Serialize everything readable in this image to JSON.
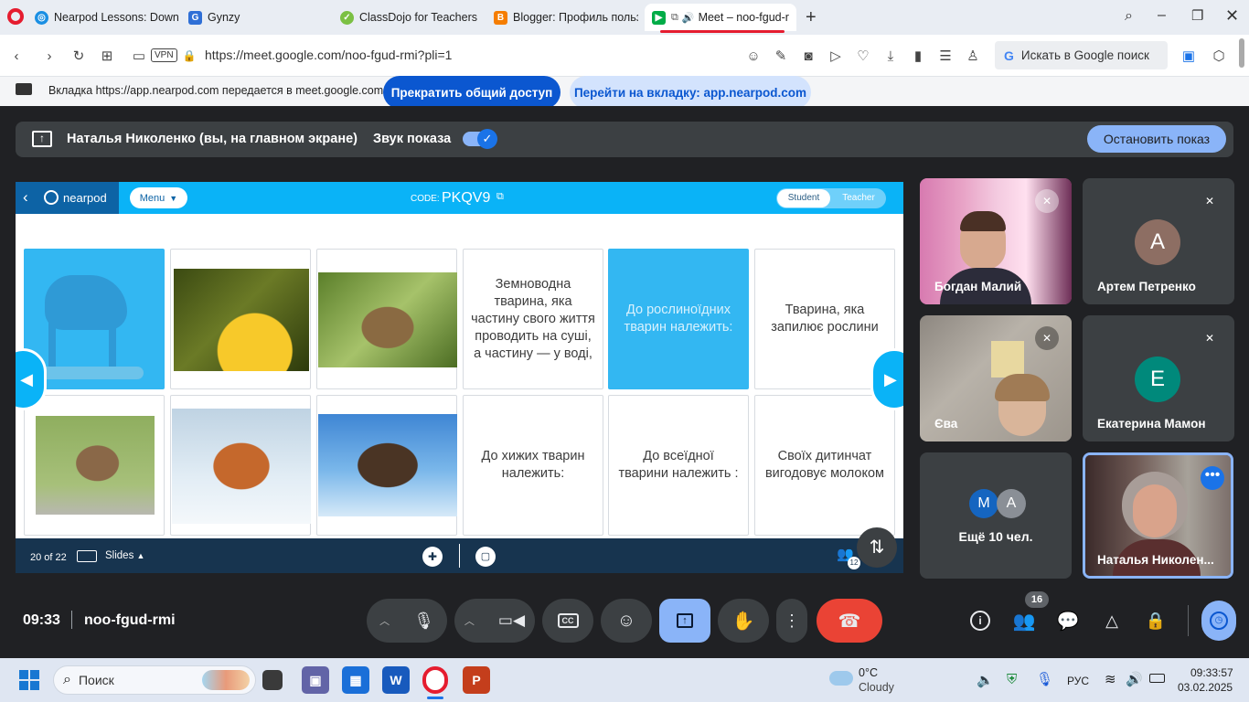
{
  "browser": {
    "tabs": [
      {
        "title": "Nearpod Lessons: Downlo",
        "active": false
      },
      {
        "title": "Gynzy",
        "active": false
      },
      {
        "title": "ClassDojo for Teachers",
        "active": false
      },
      {
        "title": "Blogger: Профиль пользо",
        "active": false
      },
      {
        "title": "Meet – noo-fgud-r",
        "active": true
      }
    ],
    "new_tab_icon": "plus-icon",
    "vpn_label": "VPN",
    "url": "https://meet.google.com/noo-fgud-rmi?pli=1",
    "search_placeholder": "Искать в Google поиск",
    "search_badge": "G"
  },
  "share_bar": {
    "text": "Вкладка https://app.nearpod.com передается в meet.google.com",
    "stop_label": "Прекратить общий доступ",
    "goto_label": "Перейти на вкладку: app.nearpod.com"
  },
  "presenting": {
    "name": "Наталья Николенко (вы, на главном экране)",
    "sound_label": "Звук показа",
    "sound_on": true,
    "stop_label": "Остановить показ"
  },
  "nearpod": {
    "logo": "nearpod",
    "menu_label": "Menu",
    "code_label": "CODE:",
    "code": "PKQV9",
    "mode_student": "Student",
    "mode_teacher": "Teacher",
    "cells": [
      {
        "type": "image",
        "img": "moose",
        "blue": true
      },
      {
        "type": "image",
        "img": "bee"
      },
      {
        "type": "image",
        "img": "toad"
      },
      {
        "type": "text",
        "text": "Земноводна тварина, яка частину свого життя проводить на суші, а частину — у воді,"
      },
      {
        "type": "text",
        "text": "До рослиноїдних тварин належить:",
        "blue": true
      },
      {
        "type": "text",
        "text": "Тварина, яка запилює рослини"
      },
      {
        "type": "image",
        "img": "sparrow"
      },
      {
        "type": "image",
        "img": "fox"
      },
      {
        "type": "image",
        "img": "eagle"
      },
      {
        "type": "text",
        "text": "До хижих тварин належить:"
      },
      {
        "type": "text",
        "text": "До всеїдної тварини належить :"
      },
      {
        "type": "text",
        "text": "Своїх дитинчат вигодовує молоком"
      }
    ],
    "slide_counter": "20 of 22",
    "slides_label": "Slides",
    "participants_badge": "12"
  },
  "participants": [
    {
      "name": "Богдан Малий",
      "type": "video",
      "muted": true
    },
    {
      "name": "Артем Петренко",
      "type": "avatar",
      "initial": "А",
      "color": "#8d6e63",
      "muted": true
    },
    {
      "name": "Єва",
      "type": "video",
      "muted": true
    },
    {
      "name": "Екатерина Мамон",
      "type": "avatar",
      "initial": "Е",
      "color": "#00897b",
      "muted": true
    },
    {
      "name": "Ещё 10 чел.",
      "type": "more",
      "initials": [
        "M",
        "А"
      ]
    },
    {
      "name": "Наталья Николен...",
      "type": "self"
    }
  ],
  "controls": {
    "time": "09:33",
    "meeting_code": "noo-fgud-rmi",
    "people_count": "16"
  },
  "taskbar": {
    "search_label": "Поиск",
    "weather_temp": "0°C",
    "weather_text": "Cloudy",
    "lang": "РУС",
    "time": "09:33:57",
    "date": "03.02.2025"
  }
}
